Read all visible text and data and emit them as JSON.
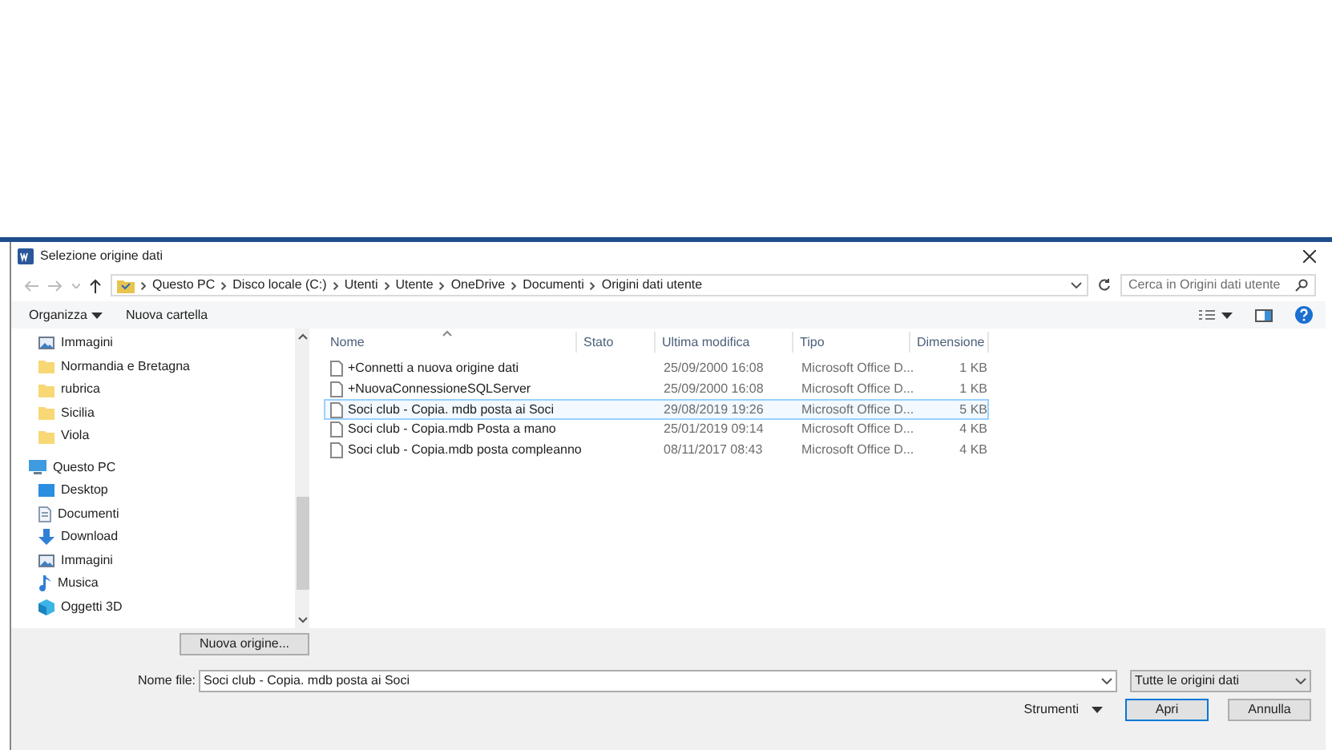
{
  "window": {
    "title": "Selezione origine dati"
  },
  "breadcrumb": [
    "Questo PC",
    "Disco locale (C:)",
    "Utenti",
    "Utente",
    "OneDrive",
    "Documenti",
    "Origini dati utente"
  ],
  "search": {
    "placeholder": "Cerca in Origini dati utente"
  },
  "toolbar": {
    "organize": "Organizza",
    "new_folder": "Nuova cartella"
  },
  "sidebar": {
    "items": [
      {
        "label": "Immagini",
        "kind": "pictures"
      },
      {
        "label": "Normandia e Bretagna",
        "kind": "folder"
      },
      {
        "label": "rubrica",
        "kind": "folder"
      },
      {
        "label": "Sicilia",
        "kind": "folder"
      },
      {
        "label": "Viola",
        "kind": "folder"
      },
      {
        "label": "Questo PC",
        "kind": "pc",
        "children": [
          {
            "label": "Desktop",
            "kind": "desktop"
          },
          {
            "label": "Documenti",
            "kind": "documents"
          },
          {
            "label": "Download",
            "kind": "download"
          },
          {
            "label": "Immagini",
            "kind": "pictures"
          },
          {
            "label": "Musica",
            "kind": "music"
          },
          {
            "label": "Oggetti 3D",
            "kind": "objects3d"
          }
        ]
      }
    ]
  },
  "table": {
    "columns": [
      "Nome",
      "Stato",
      "Ultima modifica",
      "Tipo",
      "Dimensione"
    ],
    "rows": [
      {
        "name": "+Connetti a nuova origine dati",
        "modified": "25/09/2000 16:08",
        "type": "Microsoft Office D...",
        "size": "1 KB",
        "selected": false
      },
      {
        "name": "+NuovaConnessioneSQLServer",
        "modified": "25/09/2000 16:08",
        "type": "Microsoft Office D...",
        "size": "1 KB",
        "selected": false
      },
      {
        "name": "Soci club - Copia. mdb posta ai Soci",
        "modified": "29/08/2019 19:26",
        "type": "Microsoft Office D...",
        "size": "5 KB",
        "selected": true
      },
      {
        "name": "Soci club - Copia.mdb Posta a mano",
        "modified": "25/01/2019 09:14",
        "type": "Microsoft Office D...",
        "size": "4 KB",
        "selected": false
      },
      {
        "name": "Soci club - Copia.mdb posta compleanno",
        "modified": "08/11/2017 08:43",
        "type": "Microsoft Office D...",
        "size": "4 KB",
        "selected": false
      }
    ]
  },
  "footer": {
    "new_source": "Nuova origine...",
    "filename_label": "Nome file:",
    "filename": "Soci club - Copia. mdb posta ai Soci",
    "filetype": "Tutte le origini dati",
    "tools": "Strumenti",
    "open": "Apri",
    "cancel": "Annulla"
  }
}
